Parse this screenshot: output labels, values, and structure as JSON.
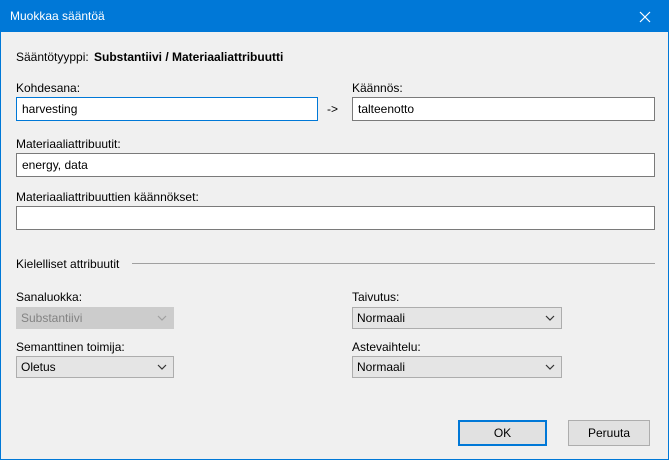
{
  "dialog": {
    "title": "Muokkaa sääntöä"
  },
  "rule_type": {
    "label": "Sääntötyyppi:",
    "value": "Substantiivi / Materiaaliattribuutti"
  },
  "target_word": {
    "label": "Kohdesana:",
    "value": "harvesting"
  },
  "arrow_text": "->",
  "translation": {
    "label": "Käännös:",
    "value": "talteenotto"
  },
  "material_attributes": {
    "label": "Materiaaliattribuutit:",
    "value": "energy, data"
  },
  "material_attribute_translations": {
    "label": "Materiaaliattribuuttien käännökset:",
    "value": ""
  },
  "linguistic_section": {
    "title": "Kielelliset attribuutit"
  },
  "word_class": {
    "label": "Sanaluokka:",
    "value": "Substantiivi",
    "enabled": false
  },
  "inflection": {
    "label": "Taivutus:",
    "value": "Normaali"
  },
  "semantic_agent": {
    "label": "Semanttinen toimija:",
    "value": "Oletus"
  },
  "gradation": {
    "label": "Astevaihtelu:",
    "value": "Normaali"
  },
  "buttons": {
    "ok": "OK",
    "cancel": "Peruuta"
  },
  "colors": {
    "title_bar": "#0078d7",
    "window_bg": "#f0f0f0",
    "focus_border": "#0078d7"
  },
  "icons": {
    "close": "close-icon",
    "dropdown": "chevron-down-icon"
  }
}
